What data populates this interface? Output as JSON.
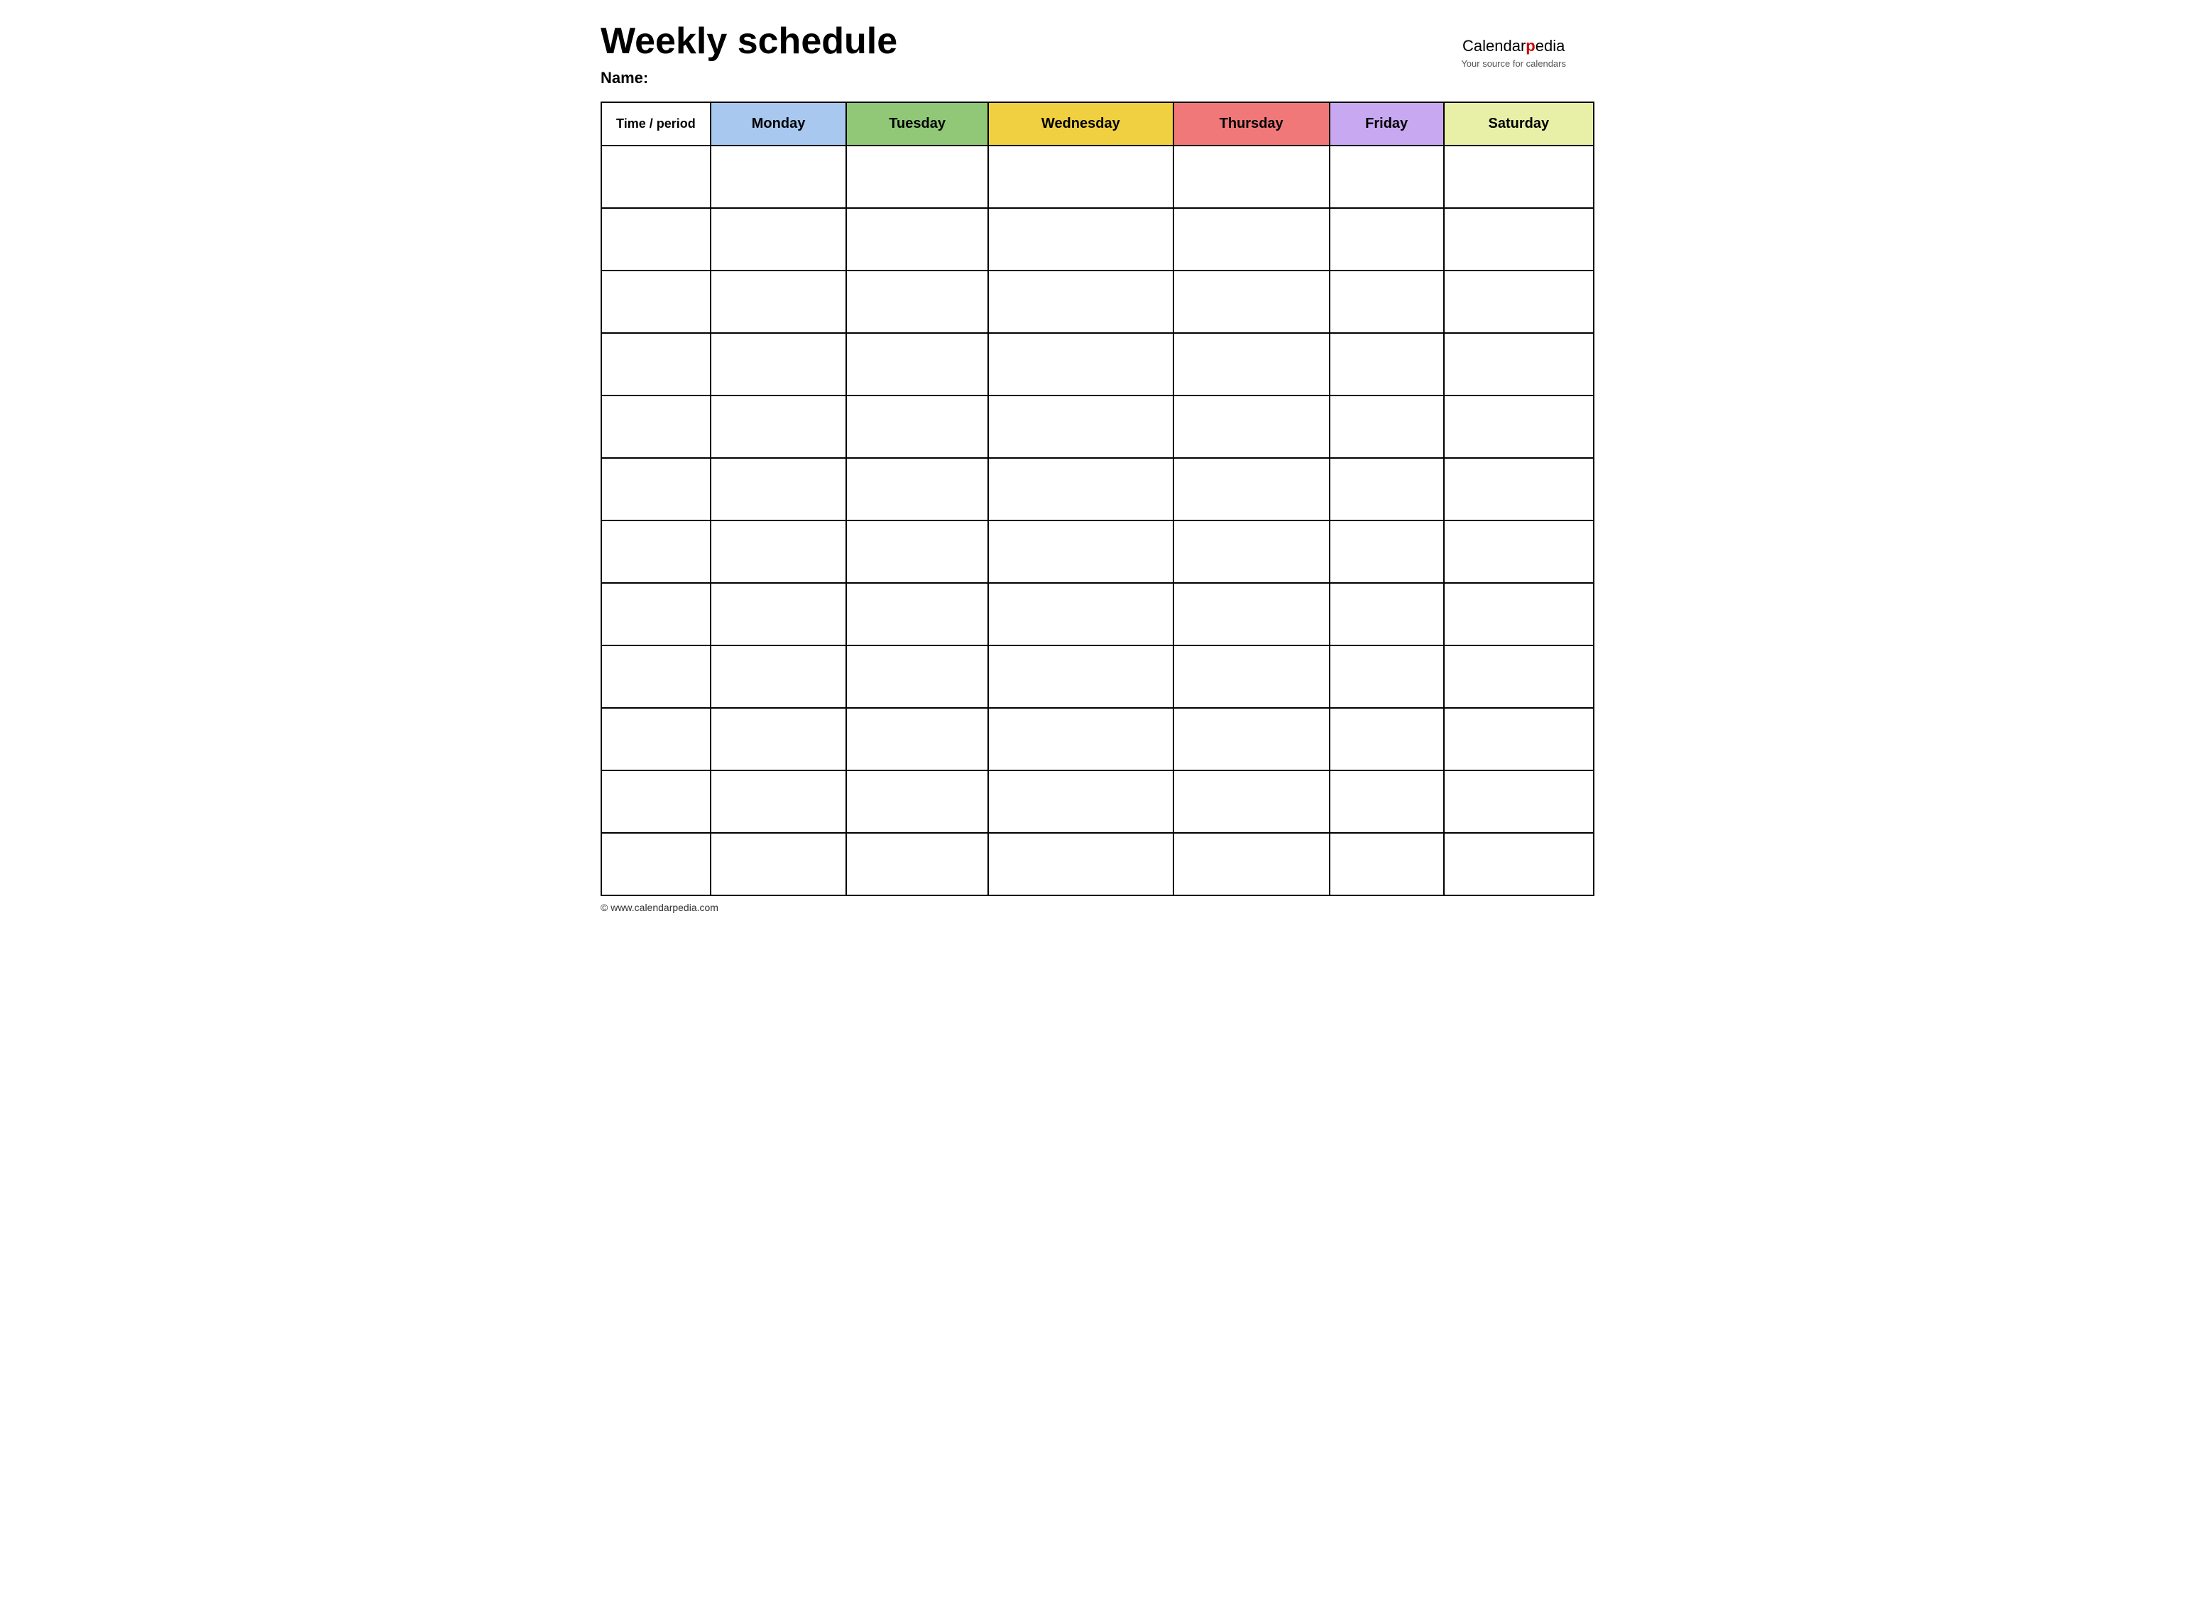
{
  "page": {
    "title": "Weekly schedule",
    "name_label": "Name:",
    "footer_text": "© www.calendarpedia.com"
  },
  "logo": {
    "brand_part1": "Calendar",
    "brand_part2": "pedia",
    "tagline": "Your source for calendars"
  },
  "table": {
    "headers": [
      {
        "id": "time",
        "label": "Time / period",
        "color_class": "header-time"
      },
      {
        "id": "monday",
        "label": "Monday",
        "color_class": "header-monday"
      },
      {
        "id": "tuesday",
        "label": "Tuesday",
        "color_class": "header-tuesday"
      },
      {
        "id": "wednesday",
        "label": "Wednesday",
        "color_class": "header-wednesday"
      },
      {
        "id": "thursday",
        "label": "Thursday",
        "color_class": "header-thursday"
      },
      {
        "id": "friday",
        "label": "Friday",
        "color_class": "header-friday"
      },
      {
        "id": "saturday",
        "label": "Saturday",
        "color_class": "header-saturday"
      }
    ],
    "row_count": 12
  }
}
